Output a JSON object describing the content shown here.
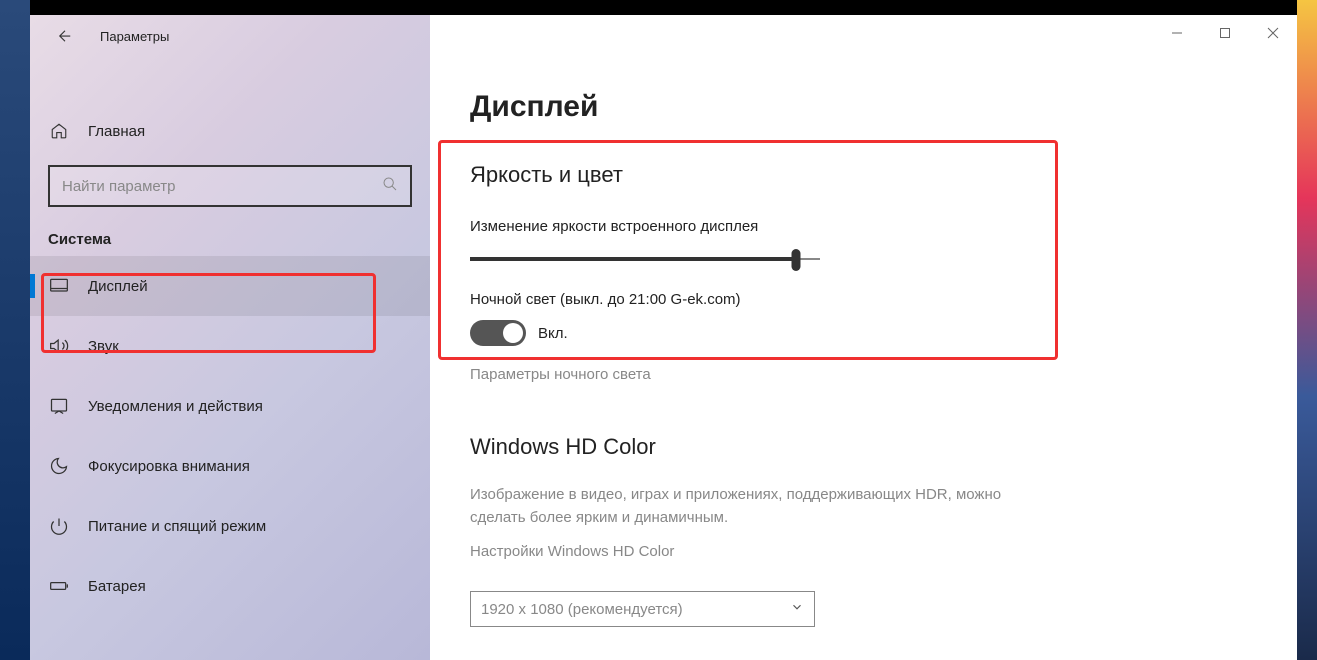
{
  "titlebar": {
    "title": "Параметры"
  },
  "sidebar": {
    "home_label": "Главная",
    "search_placeholder": "Найти параметр",
    "category": "Система",
    "items": [
      {
        "label": "Дисплей",
        "icon": "monitor",
        "selected": true
      },
      {
        "label": "Звук",
        "icon": "sound",
        "selected": false
      },
      {
        "label": "Уведомления и действия",
        "icon": "notification",
        "selected": false
      },
      {
        "label": "Фокусировка внимания",
        "icon": "focus",
        "selected": false
      },
      {
        "label": "Питание и спящий режим",
        "icon": "power",
        "selected": false
      },
      {
        "label": "Батарея",
        "icon": "battery",
        "selected": false
      }
    ]
  },
  "main": {
    "page_title": "Дисплей",
    "brightness": {
      "section_title": "Яркость и цвет",
      "slider_label": "Изменение яркости встроенного дисплея",
      "slider_value_percent": 93,
      "night_light_label": "Ночной свет (выкл. до 21:00 G-ek.com)",
      "toggle_state": "Вкл.",
      "night_light_settings_link": "Параметры ночного света"
    },
    "hd_color": {
      "section_title": "Windows HD Color",
      "desc": "Изображение в видео, играх и приложениях, поддерживающих HDR, можно сделать более ярким и динамичным.",
      "settings_link": "Настройки Windows HD Color"
    },
    "resolution": {
      "selected": "1920 х 1080 (рекомендуется)"
    }
  }
}
